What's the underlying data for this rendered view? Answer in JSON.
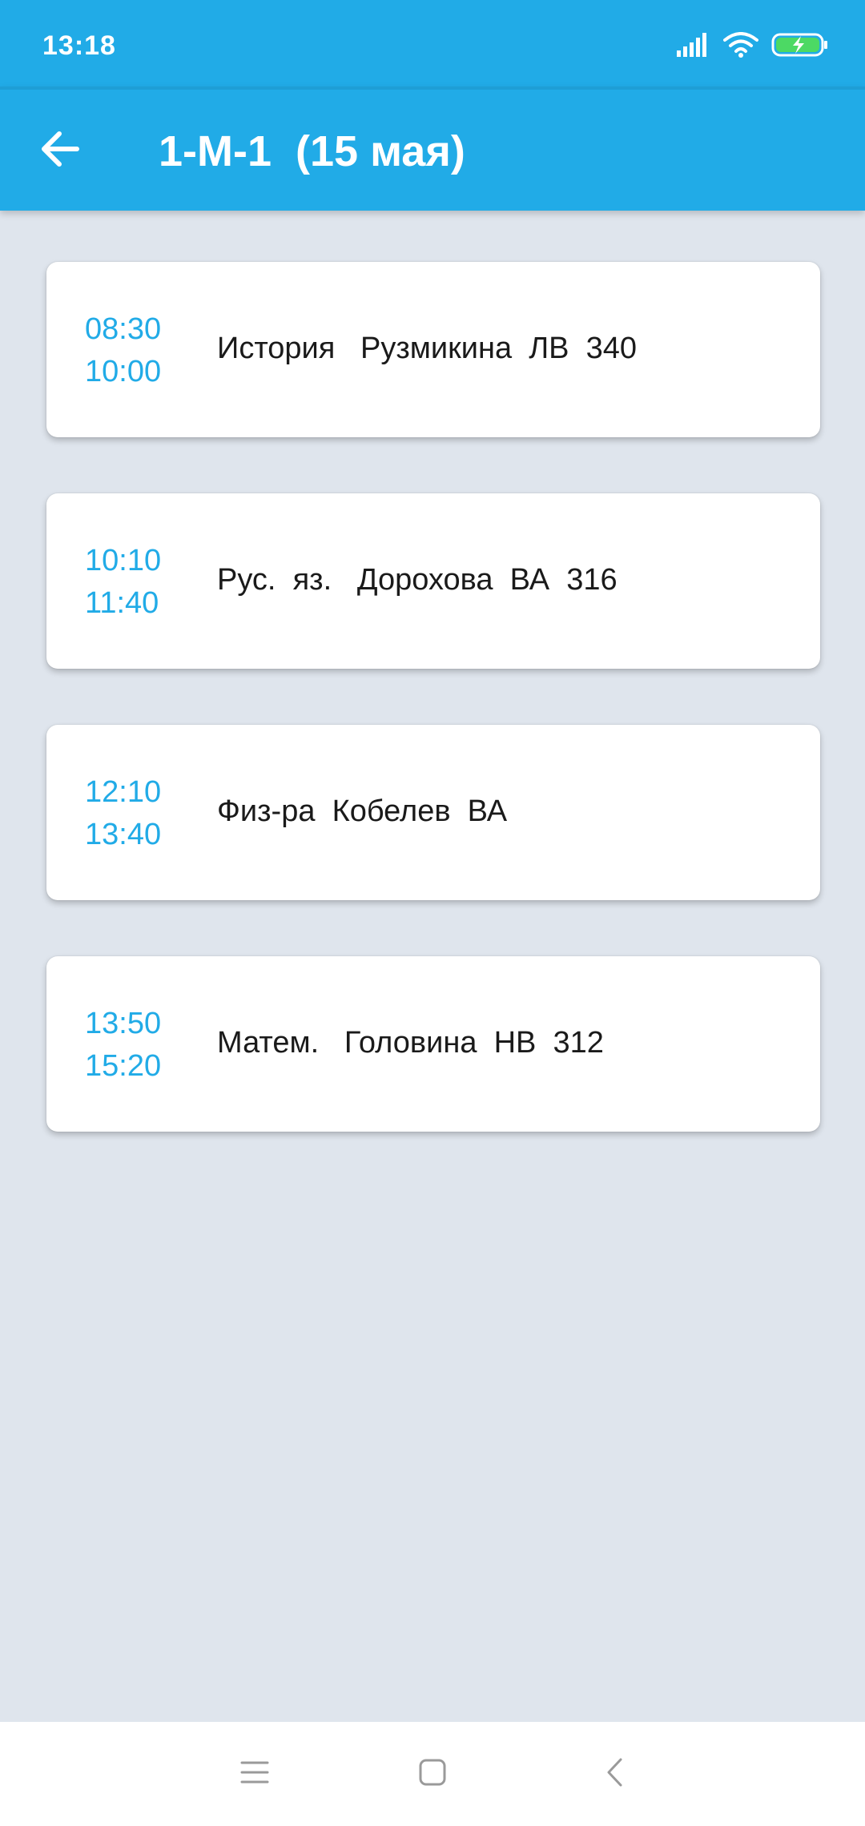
{
  "status_bar": {
    "time": "13:18",
    "icons": [
      "signal-icon",
      "wifi-icon",
      "battery-charging-icon"
    ]
  },
  "app_bar": {
    "back_icon": "arrow-left-icon",
    "title": "1-М-1  (15 мая)"
  },
  "lessons": [
    {
      "start": "08:30",
      "end": "10:00",
      "text": "История   Рузмикина  ЛВ  340"
    },
    {
      "start": "10:10",
      "end": "11:40",
      "text": "Рус.  яз.   Дорохова  ВА  316"
    },
    {
      "start": "12:10",
      "end": "13:40",
      "text": "Физ-ра  Кобелев  ВА"
    },
    {
      "start": "13:50",
      "end": "15:20",
      "text": "Матем.   Головина  НВ  312"
    }
  ],
  "nav_bar": {
    "icons": [
      "menu-icon",
      "home-icon",
      "back-icon"
    ]
  },
  "colors": {
    "accent": "#21abe7",
    "background": "#dfe5ed",
    "card": "#ffffff",
    "text": "#1a1a1a"
  }
}
